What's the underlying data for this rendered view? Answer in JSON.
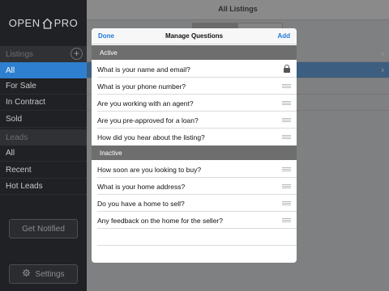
{
  "sidebar": {
    "logo_left": "OPEN",
    "logo_right": "PRO",
    "listings_header": "Listings",
    "listings_add": "+",
    "listings": [
      {
        "label": "All"
      },
      {
        "label": "For Sale"
      },
      {
        "label": "In Contract"
      },
      {
        "label": "Sold"
      }
    ],
    "leads_header": "Leads",
    "leads": [
      {
        "label": "All"
      },
      {
        "label": "Recent"
      },
      {
        "label": "Hot Leads"
      }
    ],
    "get_notified": "Get Notified",
    "settings": "Settings"
  },
  "main": {
    "title": "All Listings",
    "chevron": "›"
  },
  "modal": {
    "done": "Done",
    "title": "Manage Questions",
    "add": "Add",
    "active_header": "Active",
    "active": [
      {
        "text": "What is your name and email?",
        "locked": true
      },
      {
        "text": "What is your phone number?"
      },
      {
        "text": "Are you working with an agent?"
      },
      {
        "text": "Are you pre-approved for a loan?"
      },
      {
        "text": "How did you hear about the listing?"
      }
    ],
    "inactive_header": "Inactive",
    "inactive": [
      {
        "text": "How soon are you looking to buy?"
      },
      {
        "text": "What is your home address?"
      },
      {
        "text": "Do you have a home to sell?"
      },
      {
        "text": "Any feedback on the home for the seller?"
      }
    ]
  },
  "colors": {
    "accent": "#1f7adb",
    "sidebar_active": "#2e7fd0",
    "group_header": "#6e6e6e"
  }
}
